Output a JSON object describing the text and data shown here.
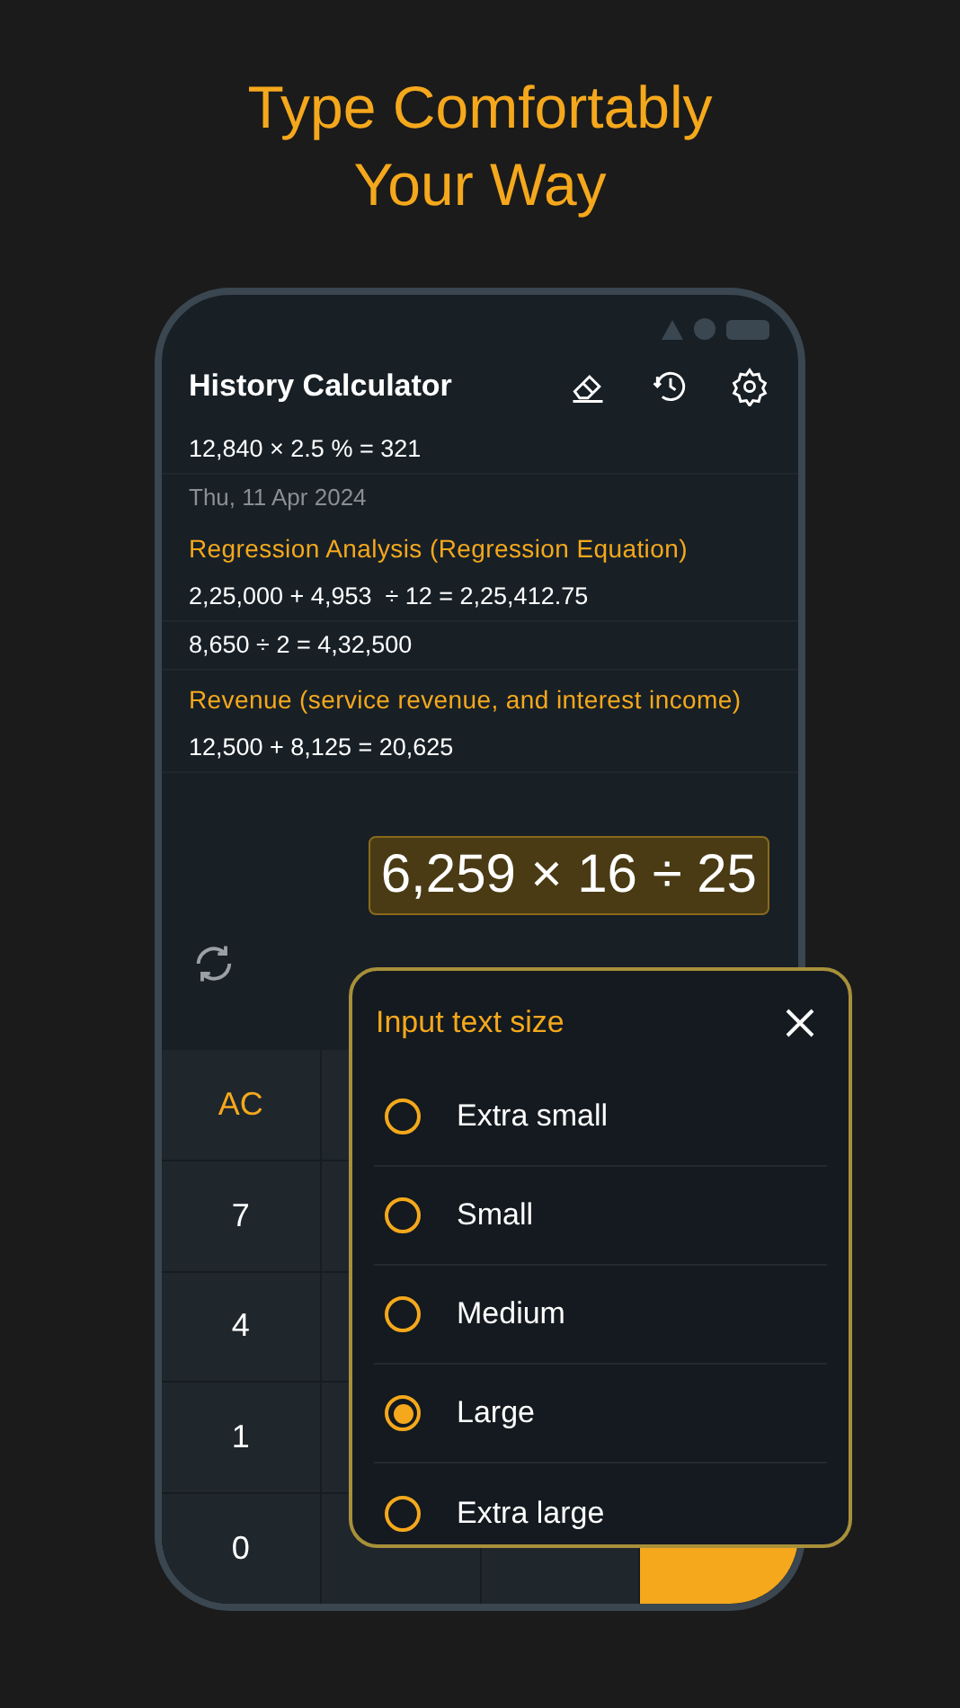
{
  "headline": "Type Comfortably Your Way",
  "app": {
    "title": "History Calculator"
  },
  "history": [
    {
      "kind": "entry",
      "text": "12,840 × 2.5 % = 321"
    },
    {
      "kind": "date",
      "text": "Thu, 11 Apr 2024"
    },
    {
      "kind": "label",
      "text": "Regression Analysis (Regression Equation)"
    },
    {
      "kind": "entry",
      "text": "2,25,000 + 4,953  ÷ 12 = 2,25,412.75"
    },
    {
      "kind": "entry",
      "text": "8,650 ÷ 2 = 4,32,500"
    },
    {
      "kind": "label",
      "text": "Revenue (service revenue, and interest income)"
    },
    {
      "kind": "entry",
      "text": "12,500 + 8,125 = 20,625"
    }
  ],
  "expression": "6,259 × 16 ÷ 25",
  "keypad": {
    "column_1": [
      {
        "kind": "function",
        "label": "AC"
      },
      {
        "kind": "digit",
        "label": "7"
      },
      {
        "kind": "digit",
        "label": "4"
      },
      {
        "kind": "digit",
        "label": "1"
      },
      {
        "kind": "digit",
        "label": "0"
      }
    ]
  },
  "dialog": {
    "title": "Input text size",
    "options": [
      {
        "label": "Extra small",
        "selected": false
      },
      {
        "label": "Small",
        "selected": false
      },
      {
        "label": "Medium",
        "selected": false
      },
      {
        "label": "Large",
        "selected": true
      },
      {
        "label": "Extra large",
        "selected": false
      }
    ]
  }
}
